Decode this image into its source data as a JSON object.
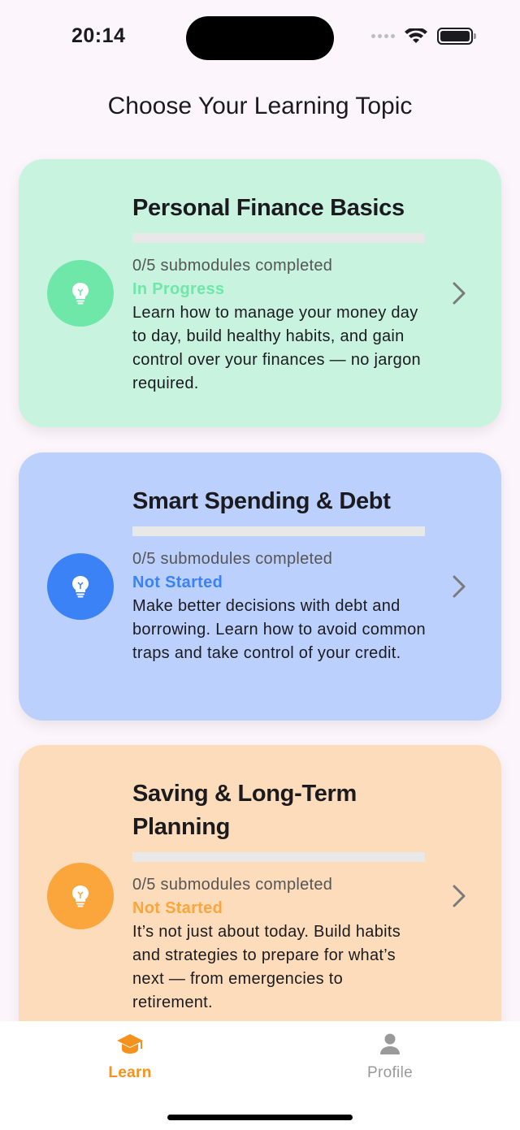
{
  "status_bar": {
    "time": "20:14"
  },
  "header": {
    "title": "Choose Your Learning Topic"
  },
  "topics": [
    {
      "title": "Personal Finance Basics",
      "progress_text": "0/5 submodules completed",
      "progress_fraction": 0,
      "status": "In Progress",
      "status_color": "#6ee7a8",
      "description": "Learn how to manage your money day to day, build healthy habits, and gain control over your finances — no jargon required.",
      "card_color": "#c8f3df",
      "icon_color": "#6ee7a8",
      "icon": "lightbulb-icon"
    },
    {
      "title": "Smart Spending & Debt",
      "progress_text": "0/5 submodules completed",
      "progress_fraction": 0,
      "status": "Not Started",
      "status_color": "#3b82f6",
      "description": "Make better decisions with debt and borrowing. Learn how to avoid common traps and take control of your credit.",
      "card_color": "#bcd0fd",
      "icon_color": "#3b82f6",
      "icon": "lightbulb-icon"
    },
    {
      "title": "Saving & Long-Term Planning",
      "progress_text": "0/5 submodules completed",
      "progress_fraction": 0,
      "status": "Not Started",
      "status_color": "#fba53d",
      "description": "It’s not just about today. Build habits and strategies to prepare for what’s next — from emergencies to retirement.",
      "card_color": "#fddcbb",
      "icon_color": "#fba53d",
      "icon": "lightbulb-icon"
    }
  ],
  "tab_bar": {
    "learn": {
      "label": "Learn",
      "icon": "graduation-cap-icon",
      "active": true,
      "color": "#f5921e"
    },
    "profile": {
      "label": "Profile",
      "icon": "person-icon",
      "active": false,
      "color": "#9a9a9a"
    }
  }
}
